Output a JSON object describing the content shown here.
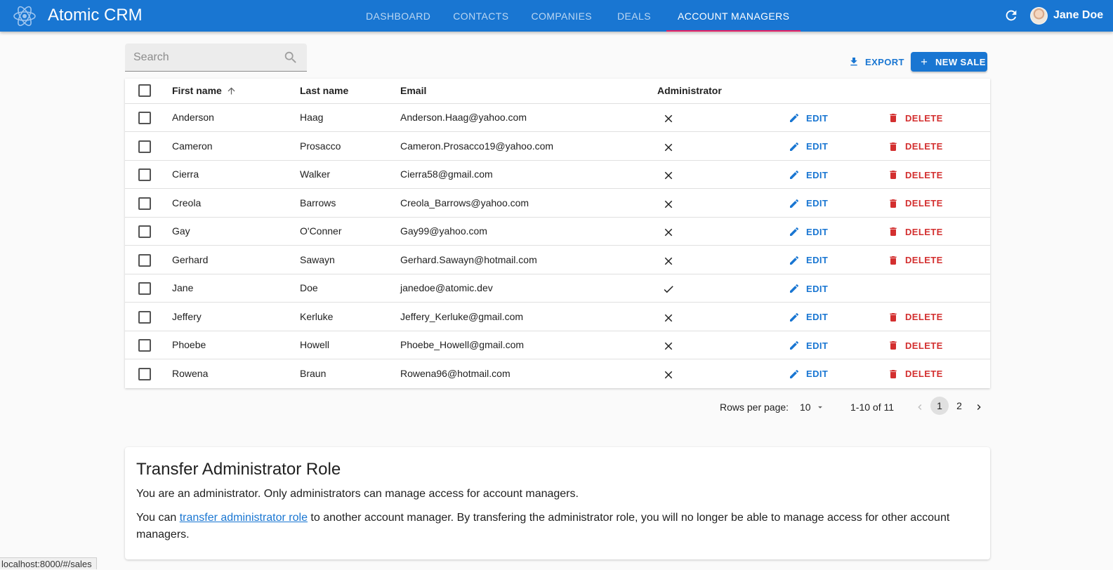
{
  "app": {
    "title": "Atomic CRM",
    "logo_icon": "react-atom-icon",
    "brand_color": "#1976d2"
  },
  "nav": {
    "tabs": [
      {
        "label": "DASHBOARD",
        "active": false
      },
      {
        "label": "CONTACTS",
        "active": false
      },
      {
        "label": "COMPANIES",
        "active": false
      },
      {
        "label": "DEALS",
        "active": false
      },
      {
        "label": "ACCOUNT MANAGERS",
        "active": true
      }
    ]
  },
  "user": {
    "name": "Jane Doe"
  },
  "toolbar": {
    "search_placeholder": "Search",
    "export_label": "EXPORT",
    "new_sale_label": "NEW SALE"
  },
  "table": {
    "columns": {
      "first_name": "First name",
      "last_name": "Last name",
      "email": "Email",
      "administrator": "Administrator"
    },
    "sort": {
      "column": "first_name",
      "direction": "asc"
    },
    "edit_label": "EDIT",
    "delete_label": "DELETE",
    "rows": [
      {
        "first_name": "Anderson",
        "last_name": "Haag",
        "email": "Anderson.Haag@yahoo.com",
        "administrator": false
      },
      {
        "first_name": "Cameron",
        "last_name": "Prosacco",
        "email": "Cameron.Prosacco19@yahoo.com",
        "administrator": false
      },
      {
        "first_name": "Cierra",
        "last_name": "Walker",
        "email": "Cierra58@gmail.com",
        "administrator": false
      },
      {
        "first_name": "Creola",
        "last_name": "Barrows",
        "email": "Creola_Barrows@yahoo.com",
        "administrator": false
      },
      {
        "first_name": "Gay",
        "last_name": "O'Conner",
        "email": "Gay99@yahoo.com",
        "administrator": false
      },
      {
        "first_name": "Gerhard",
        "last_name": "Sawayn",
        "email": "Gerhard.Sawayn@hotmail.com",
        "administrator": false
      },
      {
        "first_name": "Jane",
        "last_name": "Doe",
        "email": "janedoe@atomic.dev",
        "administrator": true
      },
      {
        "first_name": "Jeffery",
        "last_name": "Kerluke",
        "email": "Jeffery_Kerluke@gmail.com",
        "administrator": false
      },
      {
        "first_name": "Phoebe",
        "last_name": "Howell",
        "email": "Phoebe_Howell@gmail.com",
        "administrator": false
      },
      {
        "first_name": "Rowena",
        "last_name": "Braun",
        "email": "Rowena96@hotmail.com",
        "administrator": false
      }
    ]
  },
  "pagination": {
    "rows_per_page_label": "Rows per page:",
    "rows_per_page": "10",
    "range": "1-10 of 11",
    "pages": [
      "1",
      "2"
    ],
    "current_page": "1"
  },
  "transfer": {
    "title": "Transfer Administrator Role",
    "p1": "You are an administrator. Only administrators can manage access for account managers.",
    "p2_before": "You can ",
    "p2_link": "transfer administrator role",
    "p2_after": " to another account manager. By transfering the administrator role, you will no longer be able to manage access for other account managers."
  },
  "status_bar": {
    "url": "localhost:8000/#/sales"
  },
  "colors": {
    "primary": "#1976d2",
    "danger": "#d32f2f",
    "active_tab_indicator": "#e91e63"
  }
}
